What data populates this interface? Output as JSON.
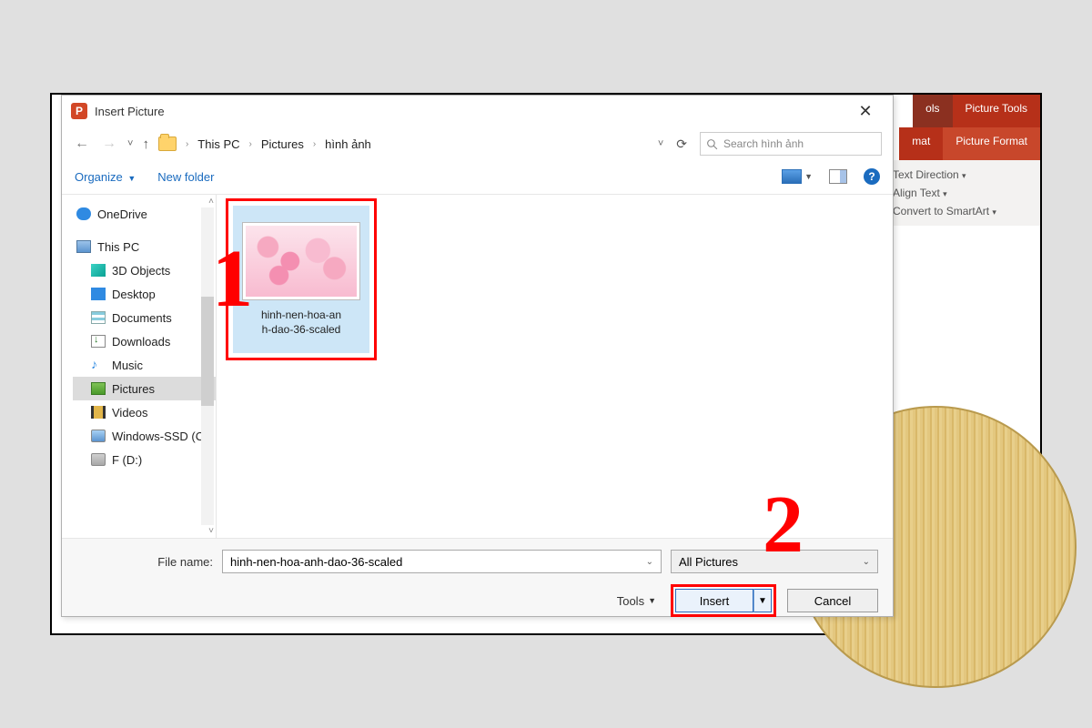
{
  "ribbon": {
    "tab_tools": "ols",
    "tab_picture_tools": "Picture Tools",
    "tab_mat": "mat",
    "tab_picture_format": "Picture Format",
    "text_direction": "Text Direction",
    "align_text": "Align Text",
    "convert_smartart": "Convert to SmartArt"
  },
  "dialog": {
    "title": "Insert Picture",
    "breadcrumb": [
      "This PC",
      "Pictures",
      "hình ảnh"
    ],
    "search_placeholder": "Search hình ảnh",
    "organize": "Organize",
    "new_folder": "New folder",
    "tree": {
      "onedrive": "OneDrive",
      "this_pc": "This PC",
      "objects_3d": "3D Objects",
      "desktop": "Desktop",
      "documents": "Documents",
      "downloads": "Downloads",
      "music": "Music",
      "pictures": "Pictures",
      "videos": "Videos",
      "windows_ssd": "Windows-SSD (C",
      "drive_f": "F (D:)"
    },
    "file": {
      "name_line1": "hinh-nen-hoa-an",
      "name_line2": "h-dao-36-scaled"
    },
    "footer": {
      "file_name_label": "File name:",
      "file_name_value": "hinh-nen-hoa-anh-dao-36-scaled",
      "filter": "All Pictures",
      "tools": "Tools",
      "insert": "Insert",
      "cancel": "Cancel"
    }
  },
  "callouts": {
    "one": "1",
    "two": "2"
  }
}
